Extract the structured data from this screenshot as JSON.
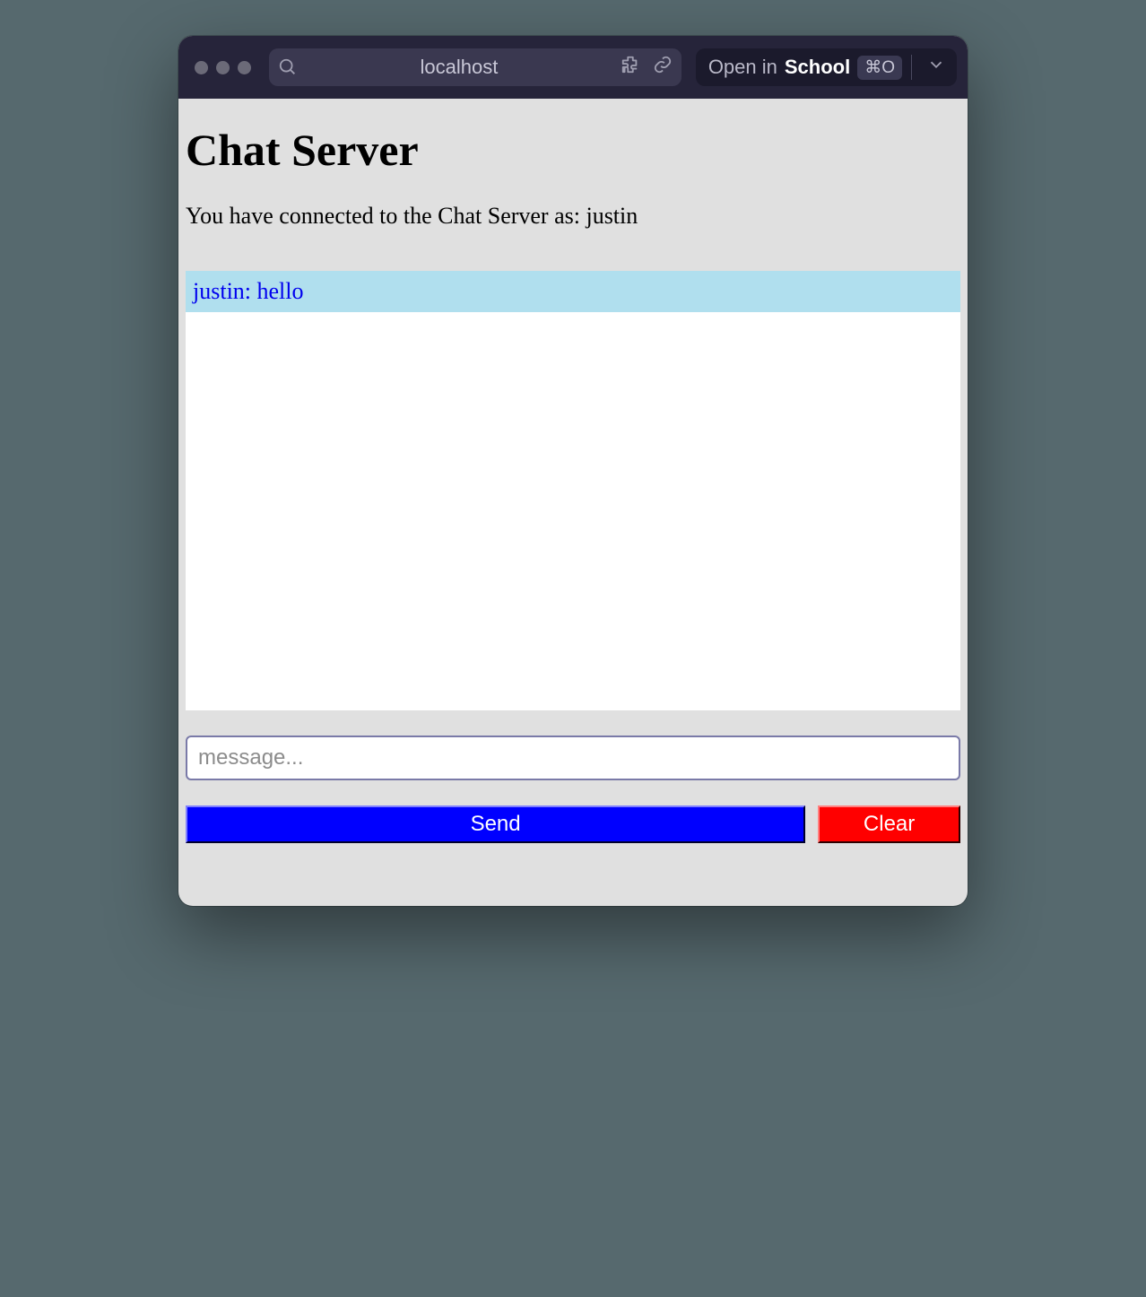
{
  "browser": {
    "url": "localhost",
    "open_in_prefix": "Open in ",
    "open_in_target": "School",
    "shortcut": "⌘O"
  },
  "page": {
    "title": "Chat Server",
    "status_prefix": "You have connected to the Chat Server as: ",
    "username": "justin"
  },
  "messages": [
    {
      "author": "justin",
      "text": "hello",
      "rendered": "justin: hello"
    }
  ],
  "compose": {
    "placeholder": "message...",
    "value": ""
  },
  "buttons": {
    "send": "Send",
    "clear": "Clear"
  }
}
